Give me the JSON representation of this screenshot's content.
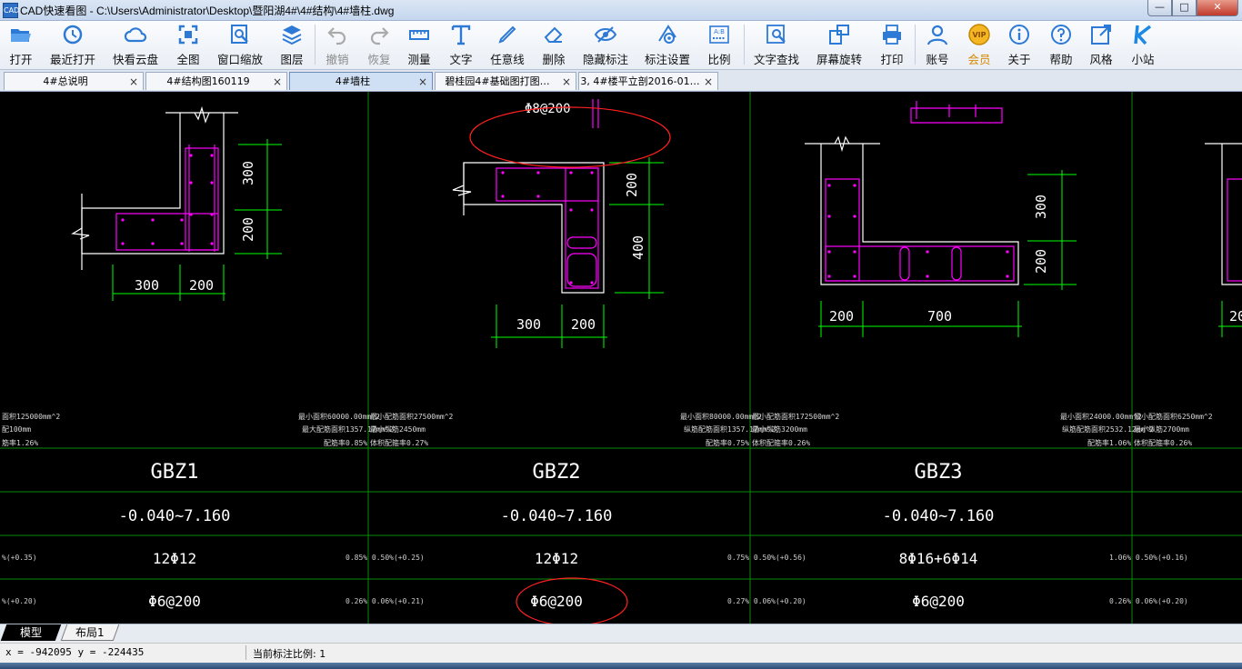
{
  "window": {
    "app_icon": "CAD",
    "title": "CAD快速看图 - C:\\Users\\Administrator\\Desktop\\暨阳湖4#\\4#结构\\4#墙柱.dwg",
    "min": "—",
    "max": "□",
    "close": "✕"
  },
  "toolbar": {
    "open": "打开",
    "recent": "最近打开",
    "cloud": "快看云盘",
    "fullview": "全图",
    "zoom_window": "窗口缩放",
    "layers": "图层",
    "undo": "撤销",
    "redo": "恢复",
    "measure": "测量",
    "text": "文字",
    "freeline": "任意线",
    "delete": "删除",
    "hide_dims": "隐藏标注",
    "dim_settings": "标注设置",
    "scale": "比例",
    "text_find": "文字查找",
    "rotate": "屏幕旋转",
    "print": "打印",
    "account": "账号",
    "vip": "会员",
    "about": "关于",
    "help": "帮助",
    "style": "风格",
    "site": "小站"
  },
  "tabs": [
    {
      "label": "4#总说明",
      "close": "×"
    },
    {
      "label": "4#结构图160119",
      "close": "×"
    },
    {
      "label": "4#墙柱",
      "close": "×"
    },
    {
      "label": "碧桂园4#基础图打图…",
      "close": "×"
    },
    {
      "label": "3, 4#楼平立剖2016-01…",
      "close": "×"
    }
  ],
  "drawing": {
    "c1": {
      "d1": "300",
      "d2": "200",
      "d3": "300",
      "d4": "200"
    },
    "c2": {
      "note": "Φ8@200",
      "d1": "200",
      "d2": "400",
      "d3": "300",
      "d4": "200"
    },
    "c3": {
      "d1": "300",
      "d2": "200",
      "d3": "200",
      "d4": "700",
      "d5": "20"
    },
    "small": {
      "s1": "面积125000mm^2",
      "s2": "配100mm",
      "s3": "筋率1.26%",
      "s4": "最小面积60000.00mm^2",
      "s5": "最大配筋面积1357.17mm^2",
      "s6": "配筋率0.85%",
      "s7": "最小配筋面积27500mm^2",
      "s8": "最小纵筋2450mm",
      "s9": "体积配箍率0.27%",
      "s10": "最小面积80000.00mm^2",
      "s11": "纵筋配筋面积1357.17mm^2",
      "s12": "配筋率0.75%",
      "s13": "最小配筋面积172500mm^2",
      "s14": "最小纵筋3200mm",
      "s15": "体积配箍率0.26%",
      "s16": "最小面积24000.00mm^2",
      "s17": "纵筋配筋面积2532.12mm^2",
      "s18": "配筋率1.06%",
      "s19": "最小配筋面积6250mm^2",
      "s20": "最小纵筋2700mm",
      "s21": "体积配箍率0.26%"
    },
    "table": {
      "row1": [
        "GBZ1",
        "GBZ2",
        "GBZ3"
      ],
      "row2": [
        "-0.040~7.160",
        "-0.040~7.160",
        "-0.040~7.160"
      ],
      "row3": [
        "12Φ12",
        "12Φ12",
        "8Φ16+6Φ14"
      ],
      "row4": [
        "Φ6@200",
        "Φ6@200",
        "Φ6@200"
      ],
      "r3notes": [
        "%(+0.35)",
        "0.85% 0.50%(+0.25)",
        "0.75% 0.50%(+0.56)",
        "1.06% 0.50%(+0.16)"
      ],
      "r4notes": [
        "%(+0.20)",
        "0.26% 0.06%(+0.21)",
        "0.27% 0.06%(+0.20)",
        "0.26% 0.06%(+0.20)"
      ]
    }
  },
  "layout_tabs": {
    "model": "模型",
    "layout1": "布局1"
  },
  "status": {
    "coords": "x = -942095 y = -224435",
    "scale_label": "当前标注比例: 1"
  },
  "colors": {
    "bg": "#000000",
    "magenta": "#ff00ff",
    "green": "#00ff00",
    "red": "#ff2020",
    "white": "#ffffff"
  }
}
